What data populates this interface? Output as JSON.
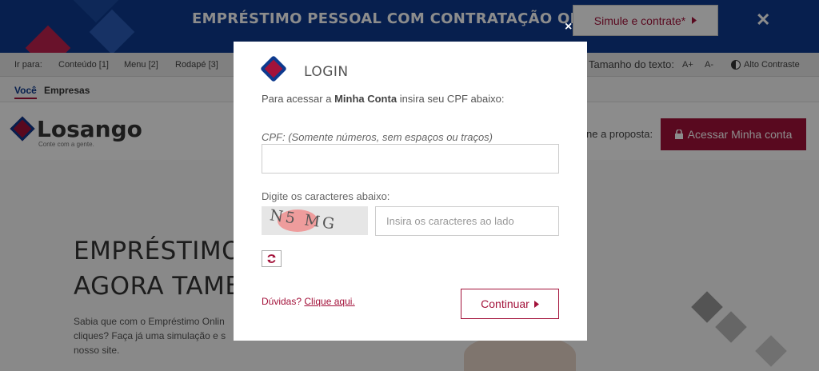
{
  "promo": {
    "title": "EMPRÉSTIMO PESSOAL COM CONTRATAÇÃO ONLINE",
    "cta_label": "Simule e contrate*",
    "close_symbol": "✕"
  },
  "accessibility": {
    "go_to": "Ir para:",
    "content": "Conteúdo [1]",
    "menu": "Menu [2]",
    "footer": "Rodapé [3]",
    "text_size": "Tamanho do texto:",
    "increase": "A+",
    "decrease": "A-",
    "contrast": "Alto Contraste"
  },
  "segments": {
    "you": "Você",
    "business": "Empresas"
  },
  "header": {
    "logo": "Losango",
    "tagline": "Conte com a gente.",
    "proposal_text": "ne a proposta:",
    "account_button": "Acessar Minha conta"
  },
  "hero": {
    "title_line1": "EMPRÉSTIMO",
    "title_line2": "AGORA TAMBE",
    "body_line1": "Sabia que com o Empréstimo Onlin",
    "body_line2": "cliques? Faça já uma simulação e s",
    "body_line3": "nosso site."
  },
  "modal": {
    "close_symbol": "×",
    "title": "LOGIN",
    "intro_prefix": "Para acessar a",
    "intro_bold": "Minha Conta",
    "intro_suffix": "insira seu CPF abaixo:",
    "cpf_label": "CPF: (Somente números, sem espaços ou traços)",
    "cpf_value": "",
    "captcha_label": "Digite os caracteres abaixo:",
    "captcha_code": "N5 MG",
    "captcha_placeholder": "Insira os caracteres ao lado",
    "help_prefix": "Dúvidas?",
    "help_link": "Clique aqui.",
    "continue_label": "Continuar"
  },
  "icons": {
    "promo_arrow": "caret-right-icon",
    "lock": "lock-icon",
    "refresh": "refresh-icon",
    "continue_arrow": "caret-right-icon",
    "contrast": "contrast-icon"
  },
  "colors": {
    "brand_blue": "#0d3a8e",
    "brand_red": "#a3123a"
  }
}
